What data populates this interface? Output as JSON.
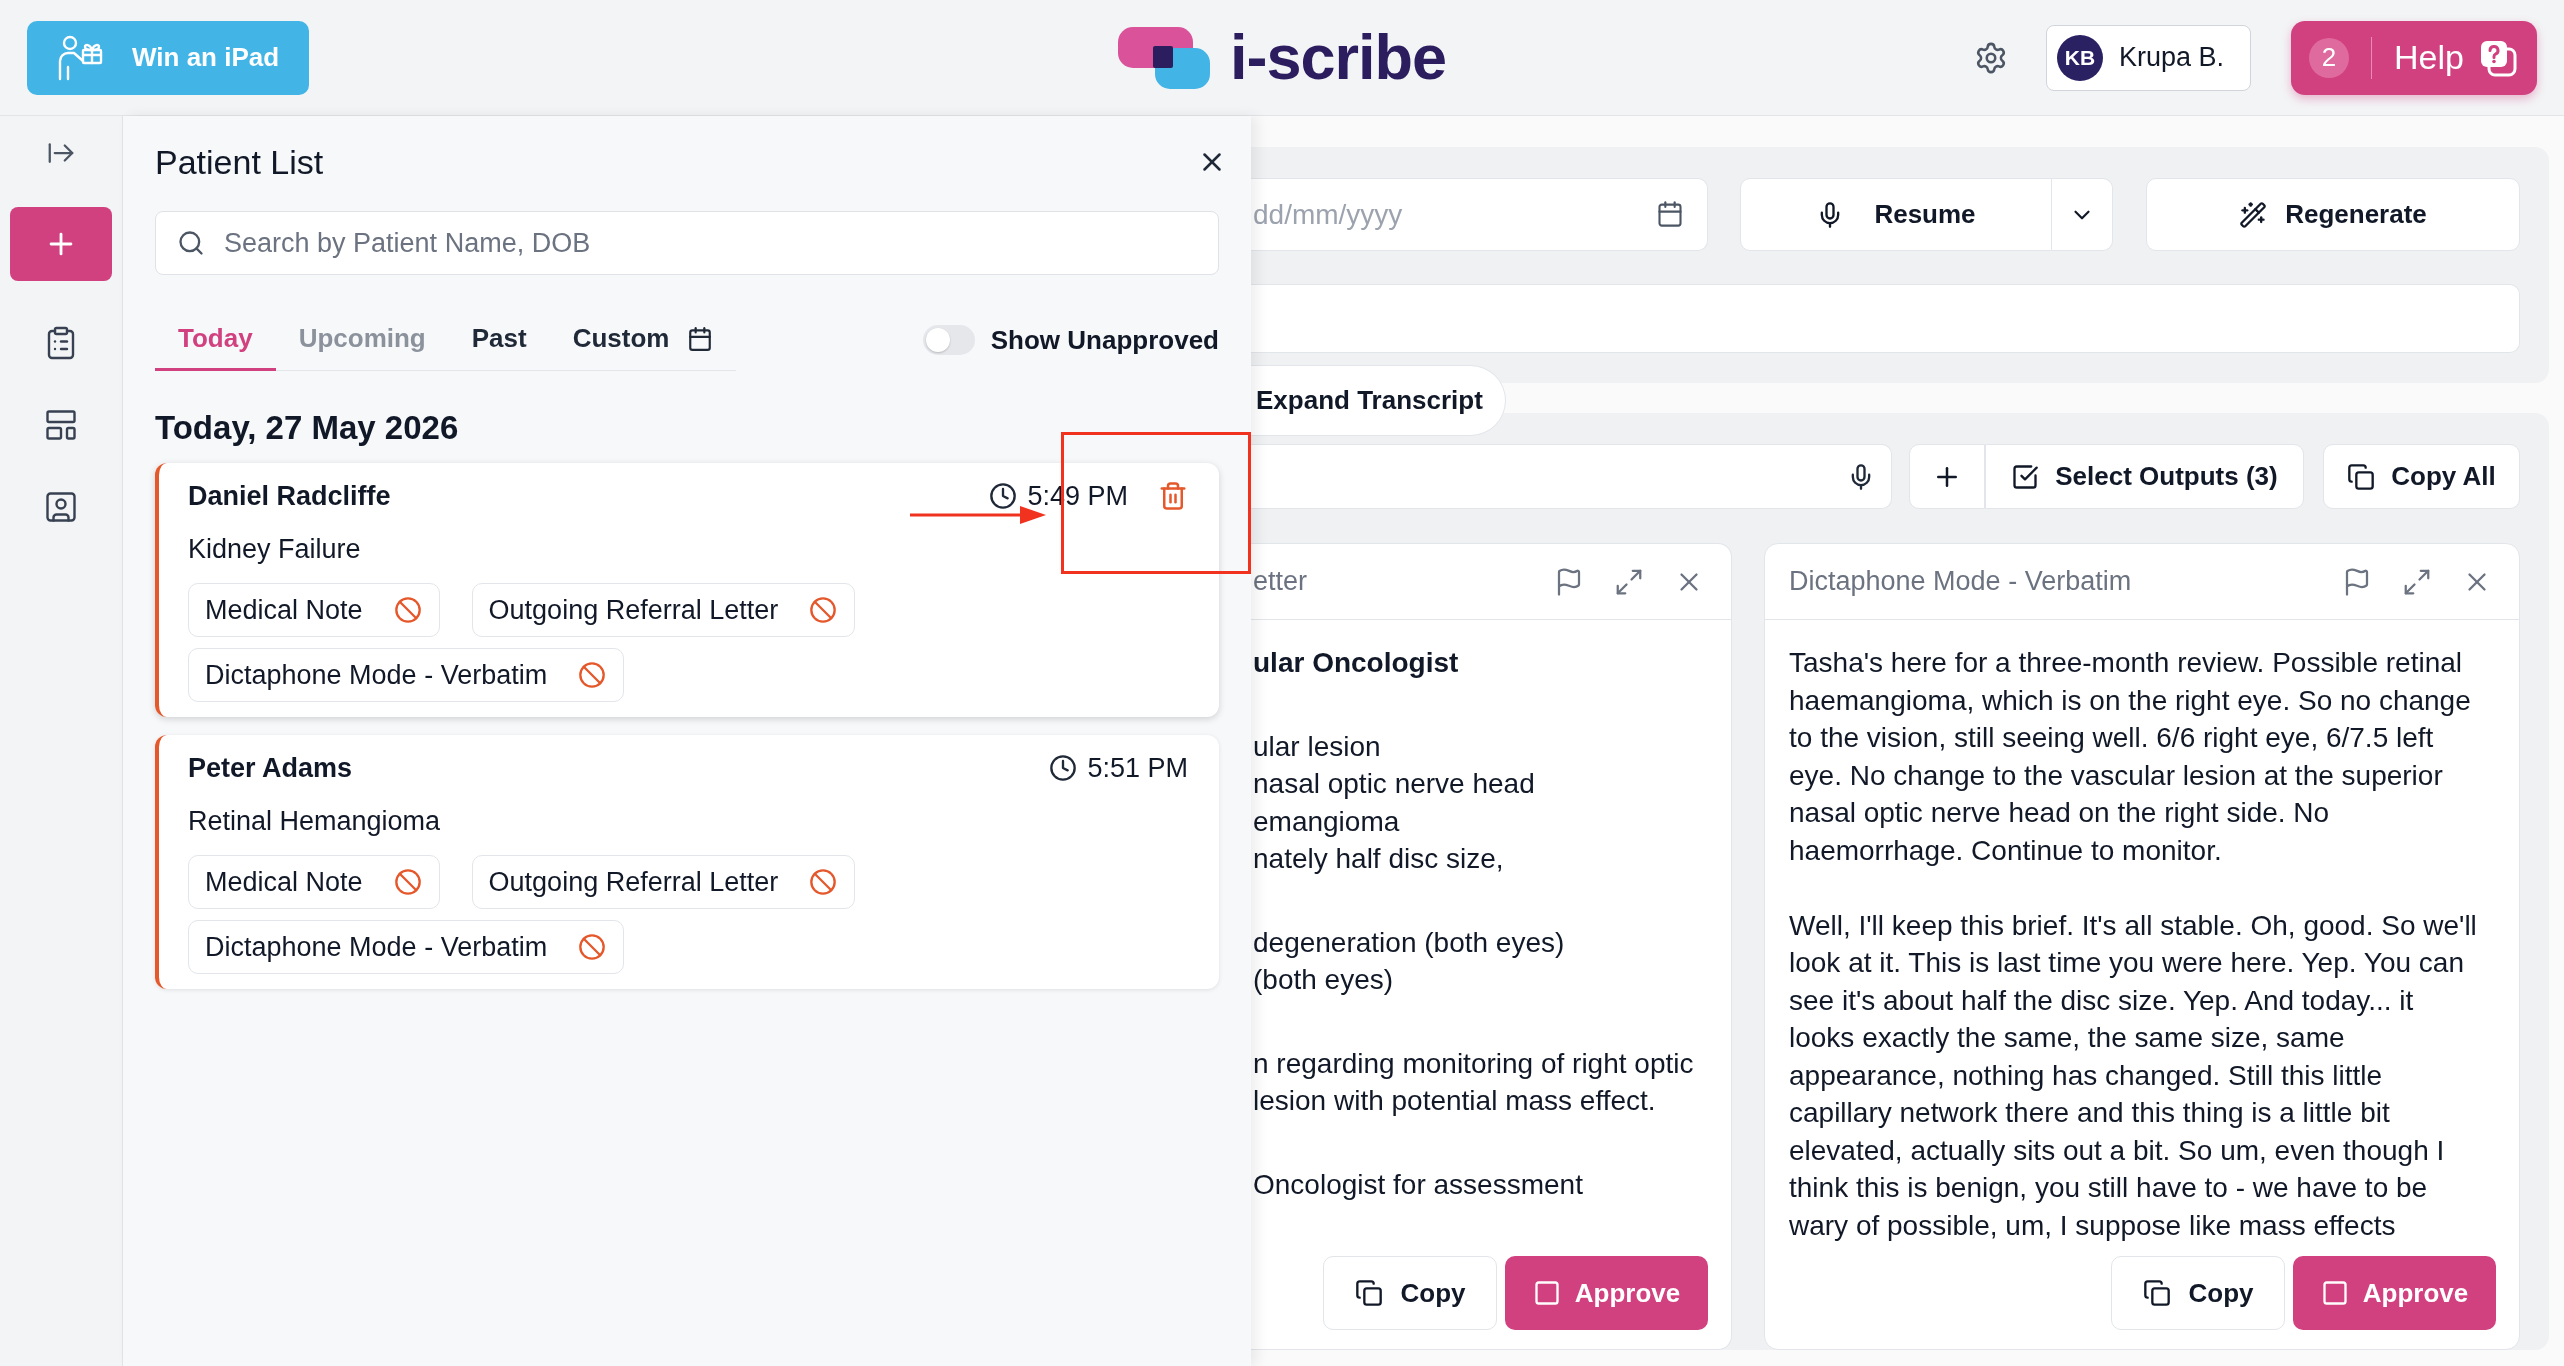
{
  "header": {
    "promo_button": "Win an iPad",
    "logo": "i-scribe",
    "user": {
      "initials": "KB",
      "name": "Krupa B."
    },
    "help": {
      "badge": "2",
      "label": "Help"
    }
  },
  "patient_list": {
    "title": "Patient List",
    "search": {
      "placeholder": "Search by Patient Name, DOB"
    },
    "tabs": [
      {
        "label": "Today",
        "kind": "preset",
        "selected": true,
        "disabled": false
      },
      {
        "label": "Upcoming",
        "kind": "preset",
        "selected": false,
        "disabled": true
      },
      {
        "label": "Past",
        "kind": "preset",
        "selected": false,
        "disabled": false
      },
      {
        "label": "Custom",
        "kind": "picker",
        "selected": false,
        "disabled": false
      }
    ],
    "show_unapproved": {
      "label": "Show Unapproved",
      "on": false
    },
    "date_heading": "Today, 27 May 2026",
    "patients": [
      {
        "name": "Daniel Radcliffe",
        "time": "5:49 PM",
        "diagnosis": "Kidney Failure",
        "hovered": true,
        "annotated": true,
        "documents": [
          {
            "label": "Medical Note",
            "approved": false
          },
          {
            "label": "Outgoing Referral Letter",
            "approved": false
          },
          {
            "label": "Dictaphone Mode - Verbatim",
            "approved": false
          }
        ]
      },
      {
        "name": "Peter Adams",
        "time": "5:51 PM",
        "diagnosis": "Retinal Hemangioma",
        "hovered": false,
        "annotated": false,
        "documents": [
          {
            "label": "Medical Note",
            "approved": false
          },
          {
            "label": "Outgoing Referral Letter",
            "approved": false
          },
          {
            "label": "Dictaphone Mode - Verbatim",
            "approved": false
          }
        ]
      }
    ]
  },
  "session": {
    "date_field": {
      "placeholder": "dd/mm/yyyy"
    },
    "resume_button": "Resume",
    "regenerate_button": "Regenerate",
    "expand_transcript": "Expand Transcript"
  },
  "outputs_toolbar": {
    "select_outputs": "Select Outputs (3)",
    "copy_all": "Copy All"
  },
  "output_cards": [
    {
      "kind": "lines",
      "title": "etter",
      "blocks": [
        {
          "kind": "heading",
          "lines": [
            "ular Oncologist"
          ]
        },
        {
          "kind": "text",
          "lines": [
            "ular lesion",
            "nasal optic nerve head",
            "emangioma",
            "nately half disc size,"
          ]
        },
        {
          "kind": "text",
          "lines": [
            "degeneration (both eyes)",
            "(both eyes)"
          ]
        },
        {
          "kind": "text",
          "lines": [
            "n regarding monitoring of right optic",
            "lesion with potential mass effect."
          ]
        },
        {
          "kind": "text",
          "lines": [
            "Oncologist for assessment"
          ]
        }
      ],
      "copy": "Copy",
      "approve": "Approve",
      "approved": false
    },
    {
      "kind": "paragraphs",
      "title": "Dictaphone Mode - Verbatim",
      "paragraphs": [
        "Tasha's here for a three-month review. Possible retinal haemangioma, which is on the right eye. So no change to the vision, still seeing well. 6/6 right eye, 6/7.5 left eye. No change to the vascular lesion at the superior nasal optic nerve head on the right side. No haemorrhage. Continue to monitor.",
        "Well, I'll keep this brief. It's all stable. Oh, good. So we'll look at it. This is last time you were here. Yep. You can see it's about half the disc size. Yep. And today... it looks exactly the same, the same size, same appearance, nothing has changed. Still this little capillary network there and this thing is a little bit elevated, actually sits out a bit. So um, even though I think this is benign, you still have to - we have to be wary of possible, um, I suppose like mass effects"
      ],
      "copy": "Copy",
      "approve": "Approve",
      "approved": false
    }
  ]
}
